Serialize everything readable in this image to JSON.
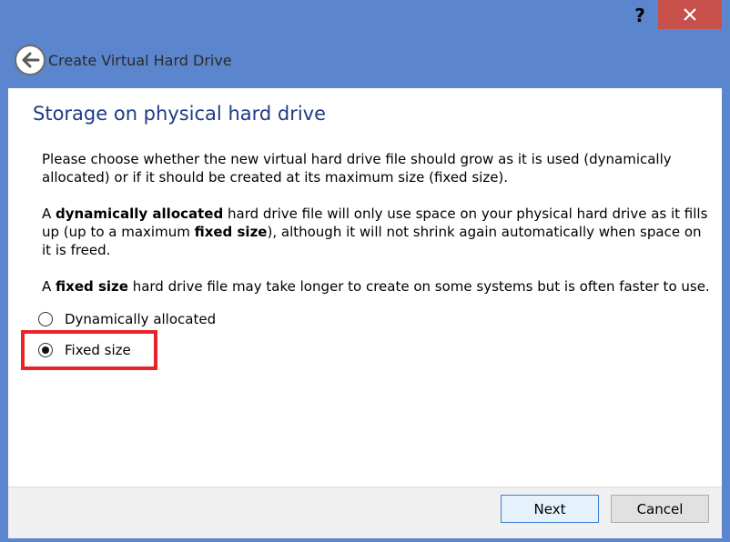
{
  "window": {
    "help_label": "?",
    "title": "Create Virtual Hard Drive"
  },
  "page": {
    "title": "Storage on physical hard drive",
    "paragraph1": "Please choose whether the new virtual hard drive file should grow as it is used (dynamically allocated) or if it should be created at its maximum size (fixed size).",
    "paragraph2": {
      "p1": "A ",
      "b1": "dynamically allocated",
      "p2": " hard drive file will only use space on your physical hard drive as it fills up (up to a maximum ",
      "b2": "fixed size",
      "p3": "), although it will not shrink again automatically when space on it is freed."
    },
    "paragraph3": {
      "p1": "A ",
      "b1": "fixed size",
      "p2": " hard drive file may take longer to create on some systems but is often faster to use."
    }
  },
  "options": {
    "dynamic": {
      "label": "Dynamically allocated",
      "selected": false
    },
    "fixed": {
      "label": "Fixed size",
      "selected": true
    }
  },
  "buttons": {
    "next": "Next",
    "cancel": "Cancel"
  },
  "colors": {
    "titlebar": "#5b86cd",
    "close": "#c7504a",
    "title_text": "#1f3a86",
    "highlight": "#e8242a"
  }
}
